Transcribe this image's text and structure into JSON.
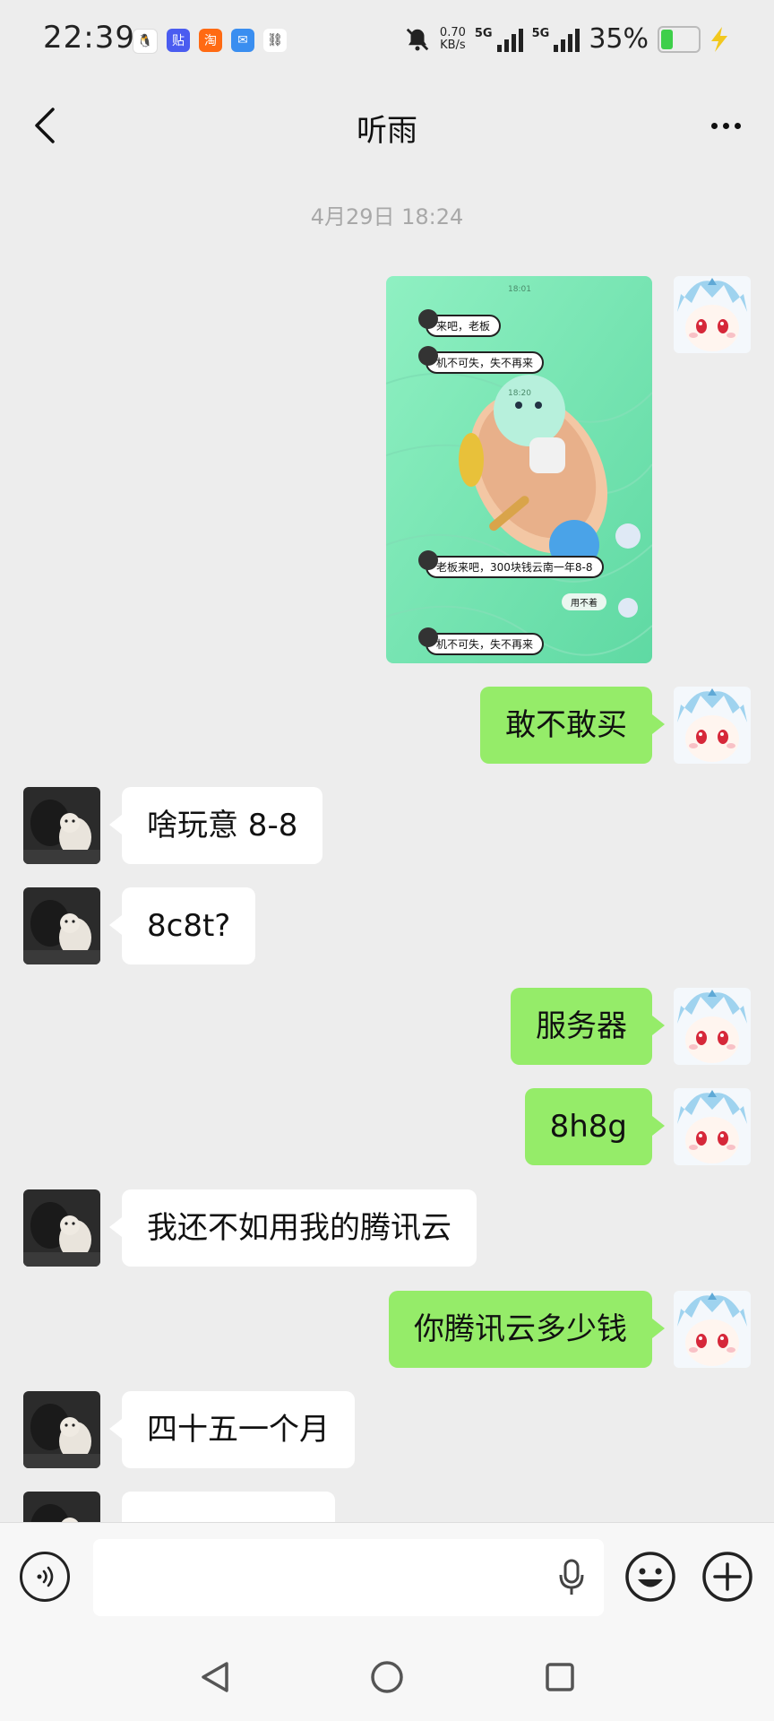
{
  "status_bar": {
    "time": "22:39",
    "net_speed": "0.70",
    "net_unit": "KB/s",
    "sim1": "5G",
    "sim2": "5G",
    "battery_pct_text": "35%",
    "battery_level": 0.35,
    "app_icons": [
      {
        "icon": "qq-penguin-icon",
        "glyph": "🐧",
        "color": "#ffffff"
      },
      {
        "icon": "tieba-icon",
        "glyph": "贴",
        "color": "#4a5cf0"
      },
      {
        "icon": "taobao-icon",
        "glyph": "淘",
        "color": "#ff6a13"
      },
      {
        "icon": "message-icon",
        "glyph": "✉",
        "color": "#3a8ef0"
      },
      {
        "icon": "link-icon",
        "glyph": "⛓",
        "color": "#ffffff"
      }
    ]
  },
  "header": {
    "title": "听雨",
    "back_icon": "chevron-left-icon",
    "more_icon": "more-dots-icon"
  },
  "chat": {
    "timestamp": "4月29日 18:24",
    "image_message": {
      "chips": [
        "来吧，老板",
        "机不可失，失不再来",
        "老板来吧，300块钱云南一年8-8",
        "用不着",
        "机不可失，失不再来"
      ],
      "inner_times": [
        "18:01",
        "18:20"
      ]
    },
    "messages": [
      {
        "side": "out",
        "text": "敢不敢买"
      },
      {
        "side": "in",
        "text": "啥玩意 8-8"
      },
      {
        "side": "in",
        "text": "8c8t?"
      },
      {
        "side": "out",
        "text": "服务器"
      },
      {
        "side": "out",
        "text": "8h8g"
      },
      {
        "side": "in",
        "text": "我还不如用我的腾讯云"
      },
      {
        "side": "out",
        "text": "你腾讯云多少钱"
      },
      {
        "side": "in",
        "text": "四十五一个月"
      }
    ]
  },
  "input_bar": {
    "voice_icon": "voice-toggle-icon",
    "mic_icon": "microphone-icon",
    "emoji_icon": "emoji-icon",
    "plus_icon": "plus-icon"
  },
  "system_nav": {
    "back": "nav-back-icon",
    "home": "nav-home-icon",
    "recents": "nav-recents-icon"
  }
}
